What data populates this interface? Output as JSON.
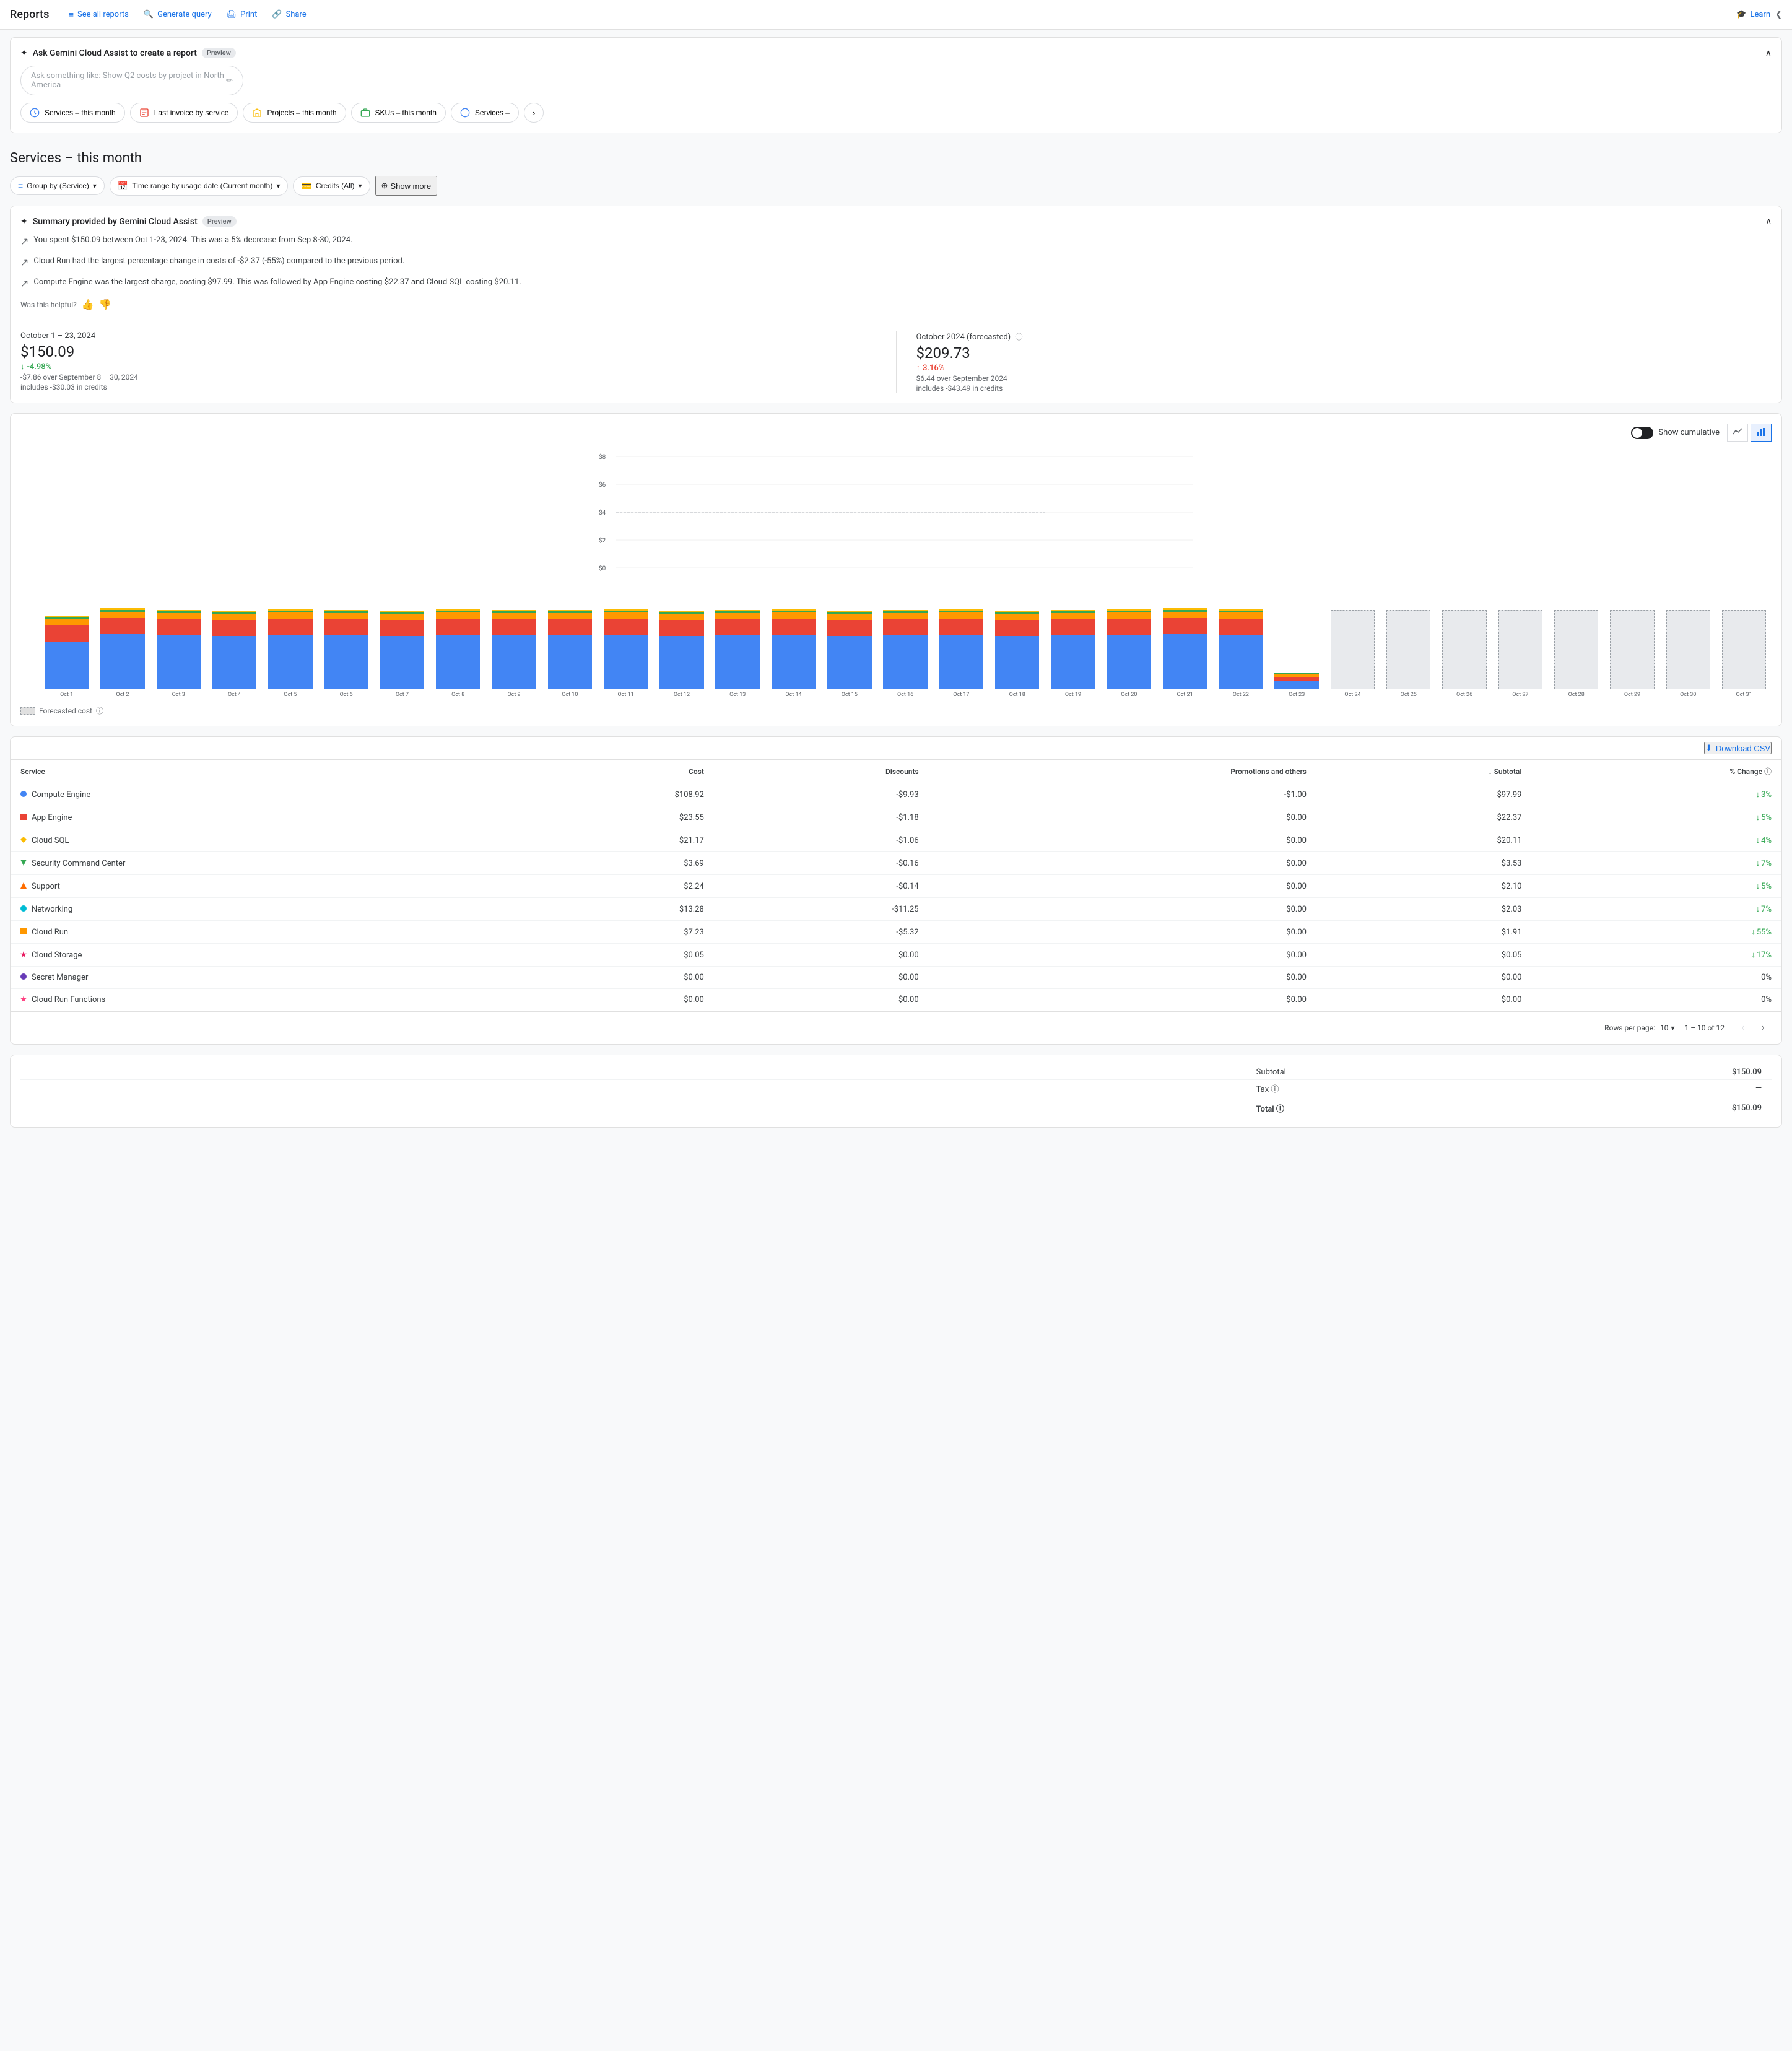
{
  "header": {
    "title": "Reports",
    "nav_links": [
      {
        "id": "see-all-reports",
        "label": "See all reports",
        "icon": "≡"
      },
      {
        "id": "generate-query",
        "label": "Generate query",
        "icon": "🔍"
      },
      {
        "id": "print",
        "label": "Print",
        "icon": "🖨"
      },
      {
        "id": "share",
        "label": "Share",
        "icon": "🔗"
      }
    ],
    "learn_label": "Learn",
    "collapse_icon": "❮"
  },
  "gemini": {
    "title": "Ask Gemini Cloud Assist to create a report",
    "preview_label": "Preview",
    "input_placeholder": "Ask something like: Show Q2 costs by project in North America",
    "quick_reports": [
      "Services – this month",
      "Last invoice by service",
      "Projects – this month",
      "SKUs – this month",
      "Services –"
    ]
  },
  "page": {
    "title": "Services – this month"
  },
  "filters": [
    {
      "id": "group-by",
      "icon": "≡",
      "label": "Group by (Service)"
    },
    {
      "id": "time-range",
      "icon": "📅",
      "label": "Time range by usage date (Current month)"
    },
    {
      "id": "credits",
      "icon": "💳",
      "label": "Credits (All)"
    }
  ],
  "show_more_label": "Show more",
  "summary": {
    "title": "Summary provided by Gemini Cloud Assist",
    "preview_label": "Preview",
    "items": [
      "You spent $150.09 between Oct 1-23, 2024. This was a 5% decrease from Sep 8-30, 2024.",
      "Cloud Run had the largest percentage change in costs of -$2.37 (-55%) compared to the previous period.",
      "Compute Engine was the largest charge, costing $97.99. This was followed by App Engine costing $22.37 and Cloud SQL costing $20.11."
    ],
    "feedback_label": "Was this helpful?",
    "thumb_up": "👍",
    "thumb_down": "👎"
  },
  "stats": {
    "current": {
      "period": "October 1 – 23, 2024",
      "amount": "$150.09",
      "change": "-4.98%",
      "change_direction": "down",
      "change_detail": "-$7.86 over September 8 – 30, 2024",
      "credits": "includes -$30.03 in credits"
    },
    "forecasted": {
      "period": "October 2024 (forecasted)",
      "amount": "$209.73",
      "change": "3.16%",
      "change_direction": "up",
      "change_detail": "$6.44 over September 2024",
      "credits": "includes -$43.49 in credits"
    }
  },
  "chart": {
    "y_labels": [
      "$8",
      "$6",
      "$4",
      "$2",
      "$0"
    ],
    "show_cumulative_label": "Show cumulative",
    "line_icon": "📈",
    "bar_icon": "📊",
    "forecasted_legend": "Forecasted cost",
    "bars": [
      {
        "label": "Oct 1",
        "blue": 65,
        "orange": 22,
        "red": 8,
        "green": 3,
        "other": 2,
        "forecasted": false
      },
      {
        "label": "Oct 2",
        "blue": 75,
        "orange": 22,
        "red": 8,
        "green": 3,
        "other": 2,
        "forecasted": false
      },
      {
        "label": "Oct 3",
        "blue": 73,
        "orange": 22,
        "red": 8,
        "green": 3,
        "other": 2,
        "forecasted": false
      },
      {
        "label": "Oct 4",
        "blue": 72,
        "orange": 22,
        "red": 8,
        "green": 3,
        "other": 2,
        "forecasted": false
      },
      {
        "label": "Oct 5",
        "blue": 74,
        "orange": 22,
        "red": 8,
        "green": 3,
        "other": 2,
        "forecasted": false
      },
      {
        "label": "Oct 6",
        "blue": 73,
        "orange": 22,
        "red": 8,
        "green": 3,
        "other": 2,
        "forecasted": false
      },
      {
        "label": "Oct 7",
        "blue": 72,
        "orange": 22,
        "red": 8,
        "green": 3,
        "other": 2,
        "forecasted": false
      },
      {
        "label": "Oct 8",
        "blue": 74,
        "orange": 22,
        "red": 8,
        "green": 3,
        "other": 2,
        "forecasted": false
      },
      {
        "label": "Oct 9",
        "blue": 73,
        "orange": 22,
        "red": 8,
        "green": 3,
        "other": 2,
        "forecasted": false
      },
      {
        "label": "Oct 10",
        "blue": 73,
        "orange": 22,
        "red": 8,
        "green": 3,
        "other": 2,
        "forecasted": false
      },
      {
        "label": "Oct 11",
        "blue": 74,
        "orange": 22,
        "red": 8,
        "green": 3,
        "other": 2,
        "forecasted": false
      },
      {
        "label": "Oct 12",
        "blue": 72,
        "orange": 22,
        "red": 8,
        "green": 3,
        "other": 2,
        "forecasted": false
      },
      {
        "label": "Oct 13",
        "blue": 73,
        "orange": 22,
        "red": 8,
        "green": 3,
        "other": 2,
        "forecasted": false
      },
      {
        "label": "Oct 14",
        "blue": 74,
        "orange": 22,
        "red": 8,
        "green": 3,
        "other": 2,
        "forecasted": false
      },
      {
        "label": "Oct 15",
        "blue": 72,
        "orange": 22,
        "red": 8,
        "green": 3,
        "other": 2,
        "forecasted": false
      },
      {
        "label": "Oct 16",
        "blue": 73,
        "orange": 22,
        "red": 8,
        "green": 3,
        "other": 2,
        "forecasted": false
      },
      {
        "label": "Oct 17",
        "blue": 74,
        "orange": 22,
        "red": 8,
        "green": 3,
        "other": 2,
        "forecasted": false
      },
      {
        "label": "Oct 18",
        "blue": 72,
        "orange": 22,
        "red": 8,
        "green": 3,
        "other": 2,
        "forecasted": false
      },
      {
        "label": "Oct 19",
        "blue": 73,
        "orange": 22,
        "red": 8,
        "green": 3,
        "other": 2,
        "forecasted": false
      },
      {
        "label": "Oct 20",
        "blue": 74,
        "orange": 22,
        "red": 8,
        "green": 3,
        "other": 2,
        "forecasted": false
      },
      {
        "label": "Oct 21",
        "blue": 75,
        "orange": 22,
        "red": 8,
        "green": 3,
        "other": 2,
        "forecasted": false
      },
      {
        "label": "Oct 22",
        "blue": 74,
        "orange": 22,
        "red": 8,
        "green": 3,
        "other": 2,
        "forecasted": false
      },
      {
        "label": "Oct 23",
        "blue": 12,
        "orange": 5,
        "red": 3,
        "green": 2,
        "other": 1,
        "forecasted": false
      },
      {
        "label": "Oct 24",
        "blue": 0,
        "orange": 0,
        "red": 0,
        "green": 0,
        "other": 0,
        "forecasted": true
      },
      {
        "label": "Oct 25",
        "blue": 0,
        "orange": 0,
        "red": 0,
        "green": 0,
        "other": 0,
        "forecasted": true
      },
      {
        "label": "Oct 26",
        "blue": 0,
        "orange": 0,
        "red": 0,
        "green": 0,
        "other": 0,
        "forecasted": true
      },
      {
        "label": "Oct 27",
        "blue": 0,
        "orange": 0,
        "red": 0,
        "green": 0,
        "other": 0,
        "forecasted": true
      },
      {
        "label": "Oct 28",
        "blue": 0,
        "orange": 0,
        "red": 0,
        "green": 0,
        "other": 0,
        "forecasted": true
      },
      {
        "label": "Oct 29",
        "blue": 0,
        "orange": 0,
        "red": 0,
        "green": 0,
        "other": 0,
        "forecasted": true
      },
      {
        "label": "Oct 30",
        "blue": 0,
        "orange": 0,
        "red": 0,
        "green": 0,
        "other": 0,
        "forecasted": true
      },
      {
        "label": "Oct 31",
        "blue": 0,
        "orange": 0,
        "red": 0,
        "green": 0,
        "other": 0,
        "forecasted": true
      }
    ]
  },
  "table": {
    "download_label": "Download CSV",
    "columns": [
      "Service",
      "Cost",
      "Discounts",
      "Promotions and others",
      "↓ Subtotal",
      "% Change ⓘ"
    ],
    "rows": [
      {
        "service": "Compute Engine",
        "color": "#4285f4",
        "shape": "circle",
        "cost": "$108.92",
        "discounts": "-$9.93",
        "promos": "-$1.00",
        "subtotal": "$97.99",
        "change": "3%",
        "direction": "down"
      },
      {
        "service": "App Engine",
        "color": "#ea4335",
        "shape": "square",
        "cost": "$23.55",
        "discounts": "-$1.18",
        "promos": "$0.00",
        "subtotal": "$22.37",
        "change": "5%",
        "direction": "down"
      },
      {
        "service": "Cloud SQL",
        "color": "#fbbc04",
        "shape": "diamond",
        "cost": "$21.17",
        "discounts": "-$1.06",
        "promos": "$0.00",
        "subtotal": "$20.11",
        "change": "4%",
        "direction": "down"
      },
      {
        "service": "Security Command Center",
        "color": "#34a853",
        "shape": "triangle-down",
        "cost": "$3.69",
        "discounts": "-$0.16",
        "promos": "$0.00",
        "subtotal": "$3.53",
        "change": "7%",
        "direction": "down"
      },
      {
        "service": "Support",
        "color": "#ff6d00",
        "shape": "triangle-up",
        "cost": "$2.24",
        "discounts": "-$0.14",
        "promos": "$0.00",
        "subtotal": "$2.10",
        "change": "5%",
        "direction": "down"
      },
      {
        "service": "Networking",
        "color": "#00bcd4",
        "shape": "circle",
        "cost": "$13.28",
        "discounts": "-$11.25",
        "promos": "$0.00",
        "subtotal": "$2.03",
        "change": "7%",
        "direction": "down"
      },
      {
        "service": "Cloud Run",
        "color": "#ff9800",
        "shape": "square",
        "cost": "$7.23",
        "discounts": "-$5.32",
        "promos": "$0.00",
        "subtotal": "$1.91",
        "change": "55%",
        "direction": "down"
      },
      {
        "service": "Cloud Storage",
        "color": "#e91e63",
        "shape": "star",
        "cost": "$0.05",
        "discounts": "$0.00",
        "promos": "$0.00",
        "subtotal": "$0.05",
        "change": "17%",
        "direction": "down"
      },
      {
        "service": "Secret Manager",
        "color": "#673ab7",
        "shape": "circle",
        "cost": "$0.00",
        "discounts": "$0.00",
        "promos": "$0.00",
        "subtotal": "$0.00",
        "change": "0%",
        "direction": "neutral"
      },
      {
        "service": "Cloud Run Functions",
        "color": "#ff4081",
        "shape": "star",
        "cost": "$0.00",
        "discounts": "$0.00",
        "promos": "$0.00",
        "subtotal": "$0.00",
        "change": "0%",
        "direction": "neutral"
      }
    ]
  },
  "pagination": {
    "rows_per_page_label": "Rows per page:",
    "rows_per_page_value": "10",
    "range": "1 – 10 of 12"
  },
  "totals": {
    "subtotal_label": "Subtotal",
    "subtotal_value": "$150.09",
    "tax_label": "Tax ⓘ",
    "tax_value": "—",
    "total_label": "Total ⓘ",
    "total_value": "$150.09"
  }
}
